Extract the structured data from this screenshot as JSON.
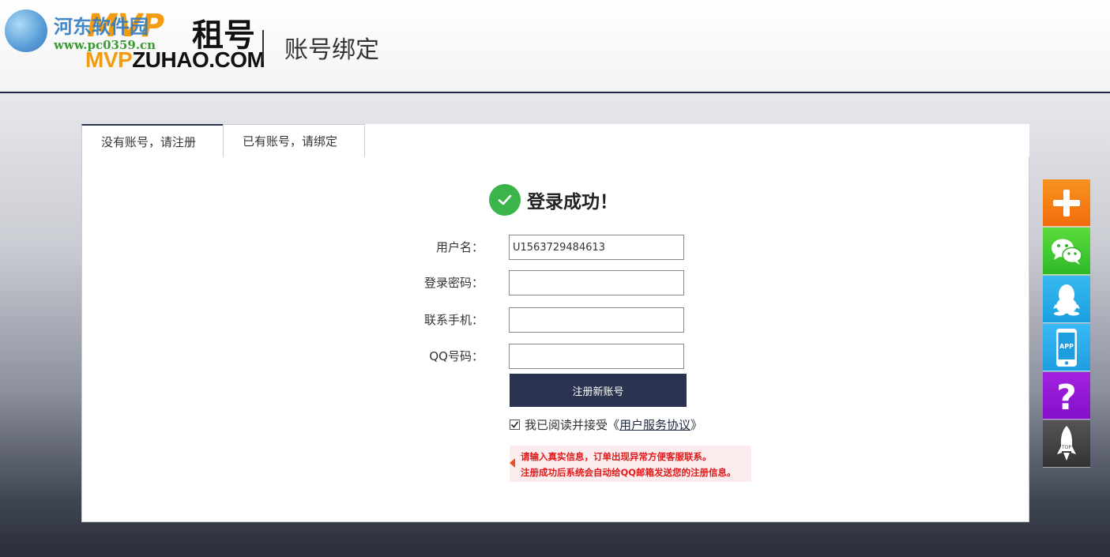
{
  "header": {
    "logo_mvp": "MVP",
    "logo_cn": "租号",
    "logo_domain_mvp": "MVP",
    "logo_domain_rest": "ZUHAO.COM",
    "page_title": "账号绑定"
  },
  "watermark": {
    "name": "河东软件园",
    "url": "www.pc0359.cn"
  },
  "tabs": [
    {
      "label": "没有账号，请注册",
      "active": true
    },
    {
      "label": "已有账号，请绑定",
      "active": false
    }
  ],
  "form": {
    "success_message": "登录成功！",
    "username_label": "用户名：",
    "username_value": "U1563729484613",
    "password_label": "登录密码：",
    "password_value": "",
    "phone_label": "联系手机：",
    "phone_value": "",
    "qq_label": "QQ号码：",
    "qq_value": "",
    "register_button": "注册新账号",
    "agree_prefix": "我已阅读并接受《",
    "agree_link": "用户服务协议",
    "agree_suffix": "》",
    "agree_checked": true,
    "notice_line1": "请输入真实信息，订单出现异常方便客服联系。",
    "notice_line2": "注册成功后系统会自动给QQ邮箱发送您的注册信息。"
  },
  "sidebar": {
    "app_label": "APP",
    "help_label": "?",
    "top_label": "TOP",
    "icons": [
      "plus-icon",
      "wechat-icon",
      "qq-icon",
      "app-phone-icon",
      "help-icon",
      "rocket-top-icon"
    ]
  },
  "colors": {
    "accent_dark": "#2a3450",
    "brand_orange": "#f39c12",
    "success_green": "#3bb54a",
    "notice_red": "#e01b1b"
  }
}
